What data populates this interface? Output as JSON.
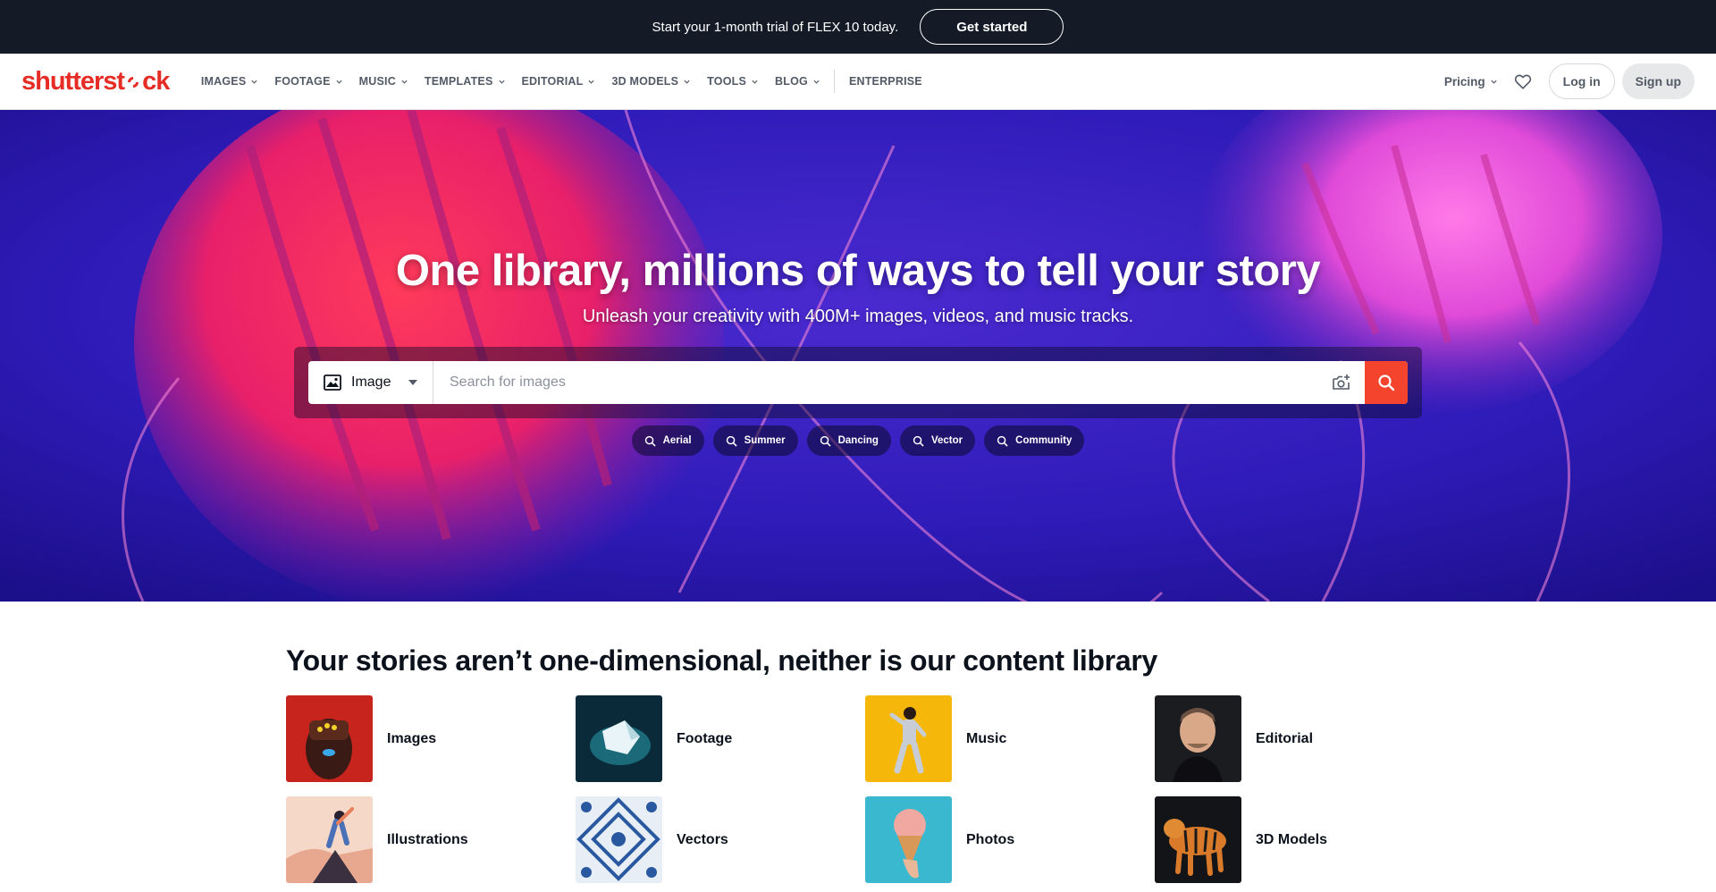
{
  "promo": {
    "text": "Start your 1-month trial of FLEX 10 today.",
    "cta": "Get started"
  },
  "nav": {
    "logo": {
      "part1": "shutterst",
      "part2": "ck"
    },
    "items": [
      "IMAGES",
      "FOOTAGE",
      "MUSIC",
      "TEMPLATES",
      "EDITORIAL",
      "3D MODELS",
      "TOOLS",
      "BLOG"
    ],
    "enterprise": "ENTERPRISE",
    "pricing": "Pricing",
    "login": "Log in",
    "signup": "Sign up"
  },
  "hero": {
    "title": "One library, millions of ways to tell your story",
    "subtitle": "Unleash your creativity with 400M+ images, videos, and music tracks.",
    "search": {
      "type": "Image",
      "placeholder": "Search for images"
    },
    "chips": [
      "Aerial",
      "Summer",
      "Dancing",
      "Vector",
      "Community"
    ]
  },
  "categories": {
    "title": "Your stories aren’t one-dimensional, neither is our content library",
    "items": [
      "Images",
      "Footage",
      "Music",
      "Editorial",
      "Illustrations",
      "Vectors",
      "Photos",
      "3D Models"
    ]
  },
  "colors": {
    "brand": "#e62d25",
    "search_button": "#f5442d",
    "promo_bg": "#141a26"
  }
}
